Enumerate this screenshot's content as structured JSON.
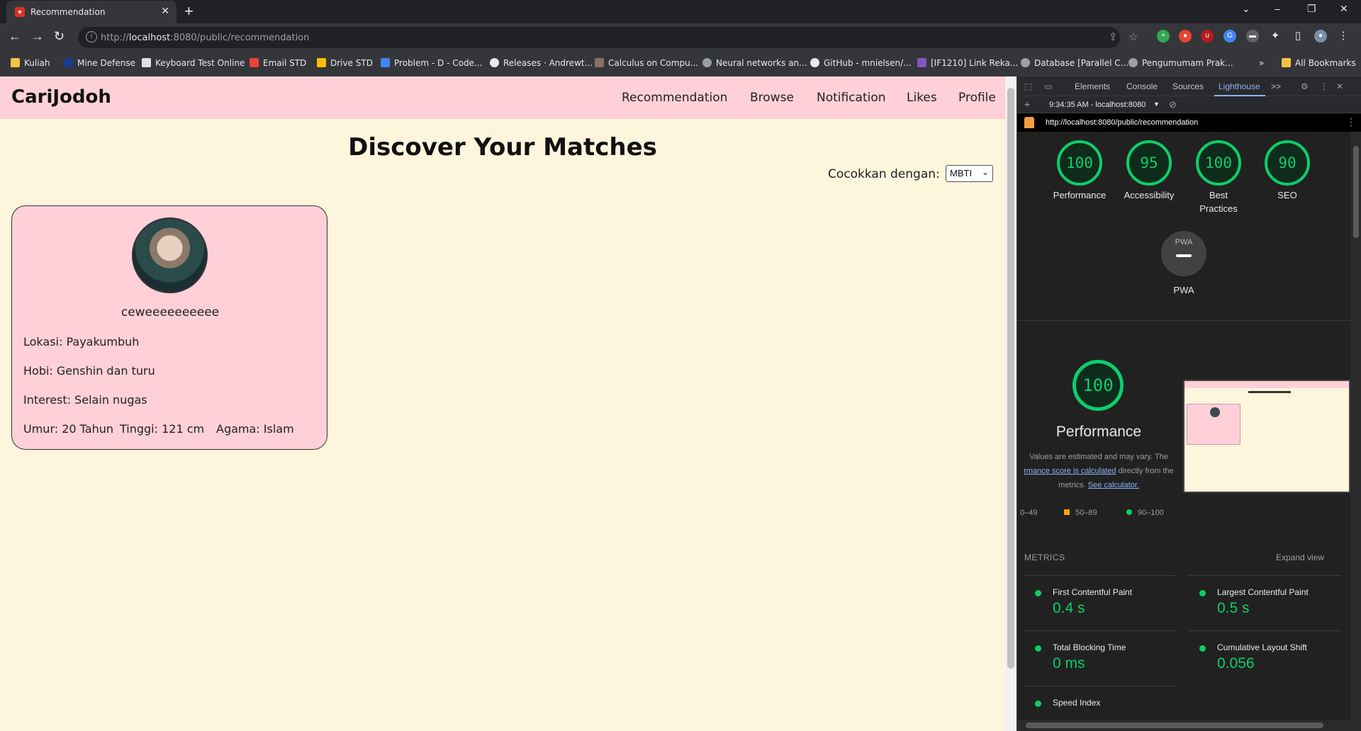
{
  "browser": {
    "tab_title": "Recommendation",
    "url_prefix": "http://",
    "url_host": "localhost",
    "url_rest": ":8080/public/recommendation",
    "bookmarks": [
      "Kuliah",
      "Mine Defense",
      "Keyboard Test Online",
      "Email STD",
      "Drive STD",
      "Problem - D - Code...",
      "Releases · Andrewt...",
      "Calculus on Compu...",
      "Neural networks an...",
      "GitHub - mnielsen/...",
      "[IF1210] Link Reka...",
      "Database [Parallel C...",
      "Pengumumam Prak...",
      "All Bookmarks"
    ],
    "bookmark_overflow": "»"
  },
  "site": {
    "logo": "CariJodoh",
    "nav": [
      "Recommendation",
      "Browse",
      "Notification",
      "Likes",
      "Profile"
    ],
    "title": "Discover Your Matches",
    "match_label": "Cocokkan dengan:",
    "match_value": "MBTI",
    "card": {
      "username": "ceweeeeeeeeee",
      "lokasi": "Lokasi: Payakumbuh",
      "hobi": "Hobi: Genshin dan turu",
      "interest": "Interest: Selain nugas",
      "umur": "Umur: 20 Tahun",
      "tinggi": "Tinggi: 121 cm",
      "agama": "Agama: Islam"
    }
  },
  "devtools": {
    "tabs": [
      "Elements",
      "Console",
      "Sources",
      "Lighthouse"
    ],
    "overflow": ">>",
    "report_time": "9:34:35 AM - localhost:8080",
    "report_url": "http://localhost:8080/public/recommendation",
    "scores": [
      {
        "label": "Performance",
        "value": "100"
      },
      {
        "label": "Accessibility",
        "value": "95"
      },
      {
        "label": "Best Practices",
        "value": "100"
      },
      {
        "label": "SEO",
        "value": "90"
      }
    ],
    "pwa_badge": "PWA",
    "pwa_label": "PWA",
    "perf_score": "100",
    "perf_title": "Performance",
    "desc_line1": "Values are estimated and may vary. The",
    "desc_link1": "rmance score is calculated",
    "desc_line2b": " directly from the",
    "desc_line3": "metrics. ",
    "desc_link2": "See calculator.",
    "legend": [
      "0–49",
      "50–89",
      "90–100"
    ],
    "metrics_header": "METRICS",
    "expand_view": "Expand view",
    "metrics": [
      {
        "name": "First Contentful Paint",
        "value": "0.4 s"
      },
      {
        "name": "Largest Contentful Paint",
        "value": "0.5 s"
      },
      {
        "name": "Total Blocking Time",
        "value": "0 ms"
      },
      {
        "name": "Cumulative Layout Shift",
        "value": "0.056"
      },
      {
        "name": "Speed Index",
        "value": ""
      }
    ]
  },
  "colors": {
    "site_nav_bg": "#ffd0d8",
    "site_bg": "#fdf5dc",
    "lh_green": "#0cce6b",
    "lh_orange": "#ffa400"
  }
}
